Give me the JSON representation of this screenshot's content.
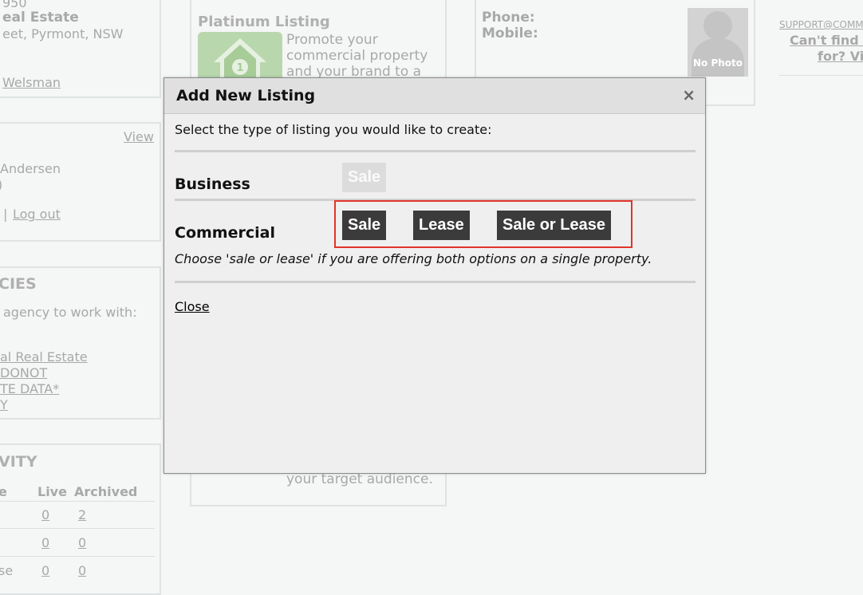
{
  "background": {
    "agency": {
      "postcode_partial": "950",
      "name_partial": "eal Estate",
      "address_partial": "eet, Pyrmont, NSW",
      "contact_link_partial": "Welsman"
    },
    "user": {
      "view_link": "View",
      "name_partial": "Andersen",
      "paren_partial": ")",
      "separator": "|",
      "logout_link": "Log out"
    },
    "agencies": {
      "heading_partial": "CIES",
      "prompt_partial": "agency to work with:",
      "links": [
        "al Real Estate",
        "DONOT",
        "TE DATA*",
        "Y"
      ]
    },
    "activity": {
      "heading_partial": "VITY",
      "columns": [
        "e",
        "Live",
        "Archived"
      ],
      "rows": [
        {
          "label": "",
          "live": "0",
          "archived": "2"
        },
        {
          "label": "",
          "live": "0",
          "archived": "0"
        },
        {
          "label": "se",
          "live": "0",
          "archived": "0"
        }
      ]
    },
    "platinum": {
      "title": "Platinum Listing",
      "description_lines": [
        "Promote your",
        "commercial property",
        "and your brand to a"
      ],
      "footer_partial": "your target audience."
    },
    "contact": {
      "phone_label": "Phone:",
      "mobile_label": "Mobile:",
      "no_photo": "No Photo"
    },
    "support": {
      "email_partial": "SUPPORT@COMM",
      "link_line1": "Can't find w",
      "link_line2": "for? Visi"
    }
  },
  "modal": {
    "title": "Add New Listing",
    "close_icon": "×",
    "prompt": "Select the type of listing you would like to create:",
    "business_label": "Business",
    "business_buttons": [
      {
        "label": "Sale",
        "enabled": false
      }
    ],
    "commercial_label": "Commercial",
    "commercial_buttons": [
      {
        "label": "Sale",
        "enabled": true
      },
      {
        "label": "Lease",
        "enabled": true
      },
      {
        "label": "Sale or Lease",
        "enabled": true
      }
    ],
    "hint": "Choose 'sale or lease' if you are offering both options on a single property.",
    "close_link": "Close",
    "highlight_color": "#e0342b"
  }
}
